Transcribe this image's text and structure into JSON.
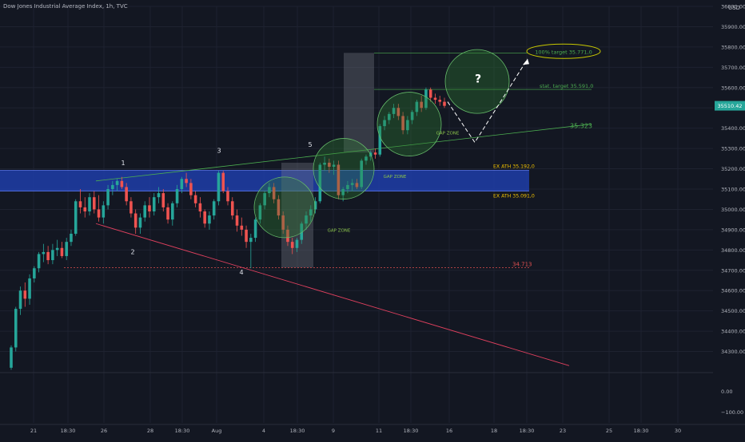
{
  "chart": {
    "title": "Dow Jones Industrial Average Index, 1h, TVC",
    "currency": "USD",
    "current_price": "35510.42"
  },
  "colors": {
    "background": "#131722",
    "up": "#26a69a",
    "down": "#ef5350",
    "band": "#1e3da8",
    "circle": "#2e7d32",
    "target": "#c8c800",
    "trend_low": "#e0405e"
  },
  "chart_data": {
    "type": "candlestick",
    "price_axis": {
      "min": 34200,
      "max": 36000,
      "ticks": [
        34300,
        34400,
        34500,
        34600,
        34700,
        34800,
        34900,
        35000,
        35100,
        35200,
        35300,
        35400,
        35500,
        35600,
        35700,
        35800,
        35900,
        36000
      ]
    },
    "oscillator_axis": {
      "ticks": [
        "0.00",
        "−100.00"
      ]
    },
    "x_ticks": [
      "21",
      "18:30",
      "26",
      "28",
      "18:30",
      "Aug",
      "4",
      "18:30",
      "9",
      "11",
      "18:30",
      "16",
      "18",
      "18:30",
      "23",
      "25",
      "18:30",
      "30"
    ],
    "candles": [
      {
        "o": 34220,
        "h": 34330,
        "l": 34210,
        "c": 34320
      },
      {
        "o": 34320,
        "h": 34520,
        "l": 34300,
        "c": 34510
      },
      {
        "o": 34510,
        "h": 34620,
        "l": 34480,
        "c": 34600
      },
      {
        "o": 34600,
        "h": 34640,
        "l": 34520,
        "c": 34560
      },
      {
        "o": 34560,
        "h": 34680,
        "l": 34530,
        "c": 34660
      },
      {
        "o": 34660,
        "h": 34720,
        "l": 34640,
        "c": 34710
      },
      {
        "o": 34710,
        "h": 34790,
        "l": 34690,
        "c": 34780
      },
      {
        "o": 34780,
        "h": 34830,
        "l": 34740,
        "c": 34790
      },
      {
        "o": 34790,
        "h": 34820,
        "l": 34730,
        "c": 34750
      },
      {
        "o": 34750,
        "h": 34830,
        "l": 34730,
        "c": 34800
      },
      {
        "o": 34800,
        "h": 34850,
        "l": 34770,
        "c": 34810
      },
      {
        "o": 34810,
        "h": 34840,
        "l": 34760,
        "c": 34770
      },
      {
        "o": 34770,
        "h": 34860,
        "l": 34750,
        "c": 34840
      },
      {
        "o": 34840,
        "h": 34900,
        "l": 34820,
        "c": 34880
      },
      {
        "o": 34880,
        "h": 35050,
        "l": 34870,
        "c": 35040
      },
      {
        "o": 35040,
        "h": 35100,
        "l": 34980,
        "c": 35010
      },
      {
        "o": 35010,
        "h": 35060,
        "l": 34960,
        "c": 34990
      },
      {
        "o": 34990,
        "h": 35080,
        "l": 34970,
        "c": 35060
      },
      {
        "o": 35060,
        "h": 35090,
        "l": 34980,
        "c": 35000
      },
      {
        "o": 35000,
        "h": 35070,
        "l": 34940,
        "c": 34960
      },
      {
        "o": 34960,
        "h": 35040,
        "l": 34930,
        "c": 35020
      },
      {
        "o": 35020,
        "h": 35120,
        "l": 35000,
        "c": 35100
      },
      {
        "o": 35100,
        "h": 35140,
        "l": 35070,
        "c": 35120
      },
      {
        "o": 35120,
        "h": 35150,
        "l": 35090,
        "c": 35140
      },
      {
        "o": 35140,
        "h": 35160,
        "l": 35100,
        "c": 35110
      },
      {
        "o": 35110,
        "h": 35130,
        "l": 35020,
        "c": 35040
      },
      {
        "o": 35040,
        "h": 35060,
        "l": 34960,
        "c": 34980
      },
      {
        "o": 34980,
        "h": 35000,
        "l": 34880,
        "c": 34910
      },
      {
        "o": 34910,
        "h": 34980,
        "l": 34880,
        "c": 34960
      },
      {
        "o": 34960,
        "h": 35040,
        "l": 34940,
        "c": 35020
      },
      {
        "o": 35020,
        "h": 35060,
        "l": 34960,
        "c": 34990
      },
      {
        "o": 34990,
        "h": 35080,
        "l": 34970,
        "c": 35060
      },
      {
        "o": 35060,
        "h": 35110,
        "l": 35030,
        "c": 35080
      },
      {
        "o": 35080,
        "h": 35100,
        "l": 34990,
        "c": 35010
      },
      {
        "o": 35010,
        "h": 35030,
        "l": 34930,
        "c": 34950
      },
      {
        "o": 34950,
        "h": 35040,
        "l": 34920,
        "c": 35030
      },
      {
        "o": 35030,
        "h": 35120,
        "l": 35010,
        "c": 35100
      },
      {
        "o": 35100,
        "h": 35160,
        "l": 35080,
        "c": 35150
      },
      {
        "o": 35150,
        "h": 35180,
        "l": 35110,
        "c": 35130
      },
      {
        "o": 35130,
        "h": 35150,
        "l": 35050,
        "c": 35070
      },
      {
        "o": 35070,
        "h": 35090,
        "l": 35010,
        "c": 35030
      },
      {
        "o": 35030,
        "h": 35060,
        "l": 34960,
        "c": 34990
      },
      {
        "o": 34990,
        "h": 35000,
        "l": 34910,
        "c": 34930
      },
      {
        "o": 34930,
        "h": 34990,
        "l": 34900,
        "c": 34970
      },
      {
        "o": 34970,
        "h": 35050,
        "l": 34950,
        "c": 35040
      },
      {
        "o": 35040,
        "h": 35190,
        "l": 35020,
        "c": 35180
      },
      {
        "o": 35180,
        "h": 35190,
        "l": 35080,
        "c": 35090
      },
      {
        "o": 35090,
        "h": 35110,
        "l": 35020,
        "c": 35040
      },
      {
        "o": 35040,
        "h": 35060,
        "l": 34950,
        "c": 34970
      },
      {
        "o": 34970,
        "h": 35000,
        "l": 34890,
        "c": 34920
      },
      {
        "o": 34920,
        "h": 34960,
        "l": 34870,
        "c": 34900
      },
      {
        "o": 34900,
        "h": 34920,
        "l": 34810,
        "c": 34840
      },
      {
        "o": 34840,
        "h": 34880,
        "l": 34710,
        "c": 34860
      },
      {
        "o": 34860,
        "h": 34960,
        "l": 34840,
        "c": 34950
      },
      {
        "o": 34950,
        "h": 35030,
        "l": 34930,
        "c": 35020
      },
      {
        "o": 35020,
        "h": 35090,
        "l": 35000,
        "c": 35080
      },
      {
        "o": 35080,
        "h": 35130,
        "l": 35060,
        "c": 35110
      },
      {
        "o": 35110,
        "h": 35130,
        "l": 35030,
        "c": 35050
      },
      {
        "o": 35050,
        "h": 35070,
        "l": 34950,
        "c": 34970
      },
      {
        "o": 34970,
        "h": 34990,
        "l": 34880,
        "c": 34900
      },
      {
        "o": 34900,
        "h": 34920,
        "l": 34820,
        "c": 34840
      },
      {
        "o": 34840,
        "h": 34860,
        "l": 34780,
        "c": 34810
      },
      {
        "o": 34810,
        "h": 34860,
        "l": 34790,
        "c": 34850
      },
      {
        "o": 34850,
        "h": 34940,
        "l": 34830,
        "c": 34930
      },
      {
        "o": 34930,
        "h": 34990,
        "l": 34900,
        "c": 34970
      },
      {
        "o": 34970,
        "h": 35020,
        "l": 34940,
        "c": 35000
      },
      {
        "o": 35000,
        "h": 35060,
        "l": 34980,
        "c": 35040
      },
      {
        "o": 35040,
        "h": 35230,
        "l": 35030,
        "c": 35220
      },
      {
        "o": 35220,
        "h": 35260,
        "l": 35190,
        "c": 35230
      },
      {
        "o": 35230,
        "h": 35250,
        "l": 35180,
        "c": 35210
      },
      {
        "o": 35210,
        "h": 35240,
        "l": 35170,
        "c": 35220
      },
      {
        "o": 35220,
        "h": 35240,
        "l": 35050,
        "c": 35070
      },
      {
        "o": 35070,
        "h": 35110,
        "l": 35040,
        "c": 35100
      },
      {
        "o": 35100,
        "h": 35140,
        "l": 35080,
        "c": 35120
      },
      {
        "o": 35120,
        "h": 35150,
        "l": 35090,
        "c": 35130
      },
      {
        "o": 35130,
        "h": 35150,
        "l": 35100,
        "c": 35110
      },
      {
        "o": 35110,
        "h": 35250,
        "l": 35100,
        "c": 35240
      },
      {
        "o": 35240,
        "h": 35270,
        "l": 35220,
        "c": 35260
      },
      {
        "o": 35260,
        "h": 35290,
        "l": 35240,
        "c": 35280
      },
      {
        "o": 35280,
        "h": 35300,
        "l": 35250,
        "c": 35270
      },
      {
        "o": 35270,
        "h": 35420,
        "l": 35260,
        "c": 35410
      },
      {
        "o": 35410,
        "h": 35460,
        "l": 35390,
        "c": 35440
      },
      {
        "o": 35440,
        "h": 35480,
        "l": 35420,
        "c": 35470
      },
      {
        "o": 35470,
        "h": 35520,
        "l": 35450,
        "c": 35500
      },
      {
        "o": 35500,
        "h": 35520,
        "l": 35440,
        "c": 35460
      },
      {
        "o": 35460,
        "h": 35480,
        "l": 35370,
        "c": 35390
      },
      {
        "o": 35390,
        "h": 35460,
        "l": 35370,
        "c": 35440
      },
      {
        "o": 35440,
        "h": 35490,
        "l": 35420,
        "c": 35480
      },
      {
        "o": 35480,
        "h": 35540,
        "l": 35460,
        "c": 35530
      },
      {
        "o": 35530,
        "h": 35560,
        "l": 35480,
        "c": 35500
      },
      {
        "o": 35500,
        "h": 35600,
        "l": 35490,
        "c": 35590
      },
      {
        "o": 35590,
        "h": 35600,
        "l": 35530,
        "c": 35550
      },
      {
        "o": 35550,
        "h": 35570,
        "l": 35520,
        "c": 35540
      },
      {
        "o": 35540,
        "h": 35560,
        "l": 35510,
        "c": 35530
      },
      {
        "o": 35530,
        "h": 35550,
        "l": 35500,
        "c": 35510
      }
    ],
    "levels": [
      {
        "price": 35771.0,
        "label": "100% target 35.771,0"
      },
      {
        "price": 35591.0,
        "label": "stat. target 35.591,0"
      },
      {
        "price": 35192.0,
        "label": "EX ATH 35.192,0"
      },
      {
        "price": 35091.0,
        "label": "EX ATH 35.091,0"
      },
      {
        "price": 34713.0,
        "label": "34.713"
      },
      {
        "price": 35323.0,
        "label": "35.323"
      }
    ],
    "wave_labels": [
      "1",
      "2",
      "3",
      "4",
      "5"
    ],
    "gap_zone_label": "GAP ZONE",
    "question_mark": "?"
  }
}
